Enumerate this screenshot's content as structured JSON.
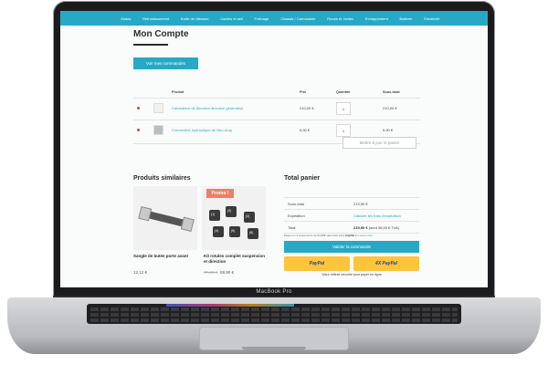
{
  "device_label": "MacBook Pro",
  "nav": {
    "items": [
      "Motos",
      "Refroidissement",
      "Boîte de vitesses",
      "Cadres et sell",
      "Freinage",
      "Chassis / Carrosserie",
      "Roues et Jantes",
      "Echappement",
      "Batterie",
      "Electricité"
    ]
  },
  "page": {
    "title": "Mon Compte",
    "orders_button": "Voir mes commandes"
  },
  "cart": {
    "headers": {
      "product": "Produit",
      "price": "Prix",
      "quantity": "Quantité",
      "subtotal": "Sous-total"
    },
    "rows": [
      {
        "name": "Calculateur de direction direction génération",
        "price": "210,00 €",
        "qty": "1",
        "subtotal": "210,00 €"
      },
      {
        "name": "Connecteur hydraulique de Neo-Amp",
        "price": "9,90 €",
        "qty": "1",
        "subtotal": "9,90 €"
      }
    ],
    "update_button": "Mettre à jour le panier"
  },
  "similar": {
    "title": "Produits similaires",
    "promo_badge": "Promo !",
    "products": [
      {
        "name": "Sangle de butée porte avant",
        "price": "12,12 €",
        "old_price": ""
      },
      {
        "name": "Kit rotules complet suspension et direction",
        "price": "69,90 €",
        "old_price": "77,49 €"
      }
    ],
    "kit_labels": [
      "(1)",
      "(2)",
      "(3)",
      "(4)",
      "(5)",
      "(6)"
    ]
  },
  "totals": {
    "title": "Total panier",
    "rows": [
      {
        "label": "Sous-total",
        "value": "219,90 €"
      },
      {
        "label": "Expédition",
        "value": "Calculer les frais d'expédition"
      },
      {
        "label": "Total",
        "value": "219,90 €",
        "extra": "(dont 36,65 € TVA)"
      }
    ],
    "paypal_note_pre": "Payez en 4 versements de 54,98€ sans frais avec",
    "paypal_brand": "PayPal",
    "paypal_link": "En savoir plus",
    "checkout_button": "Valider la commande",
    "paypal_button": "PayPal",
    "paypal_4x_button": "4X PayPal",
    "secure_note": "Votre réflexe sécurité pour payer en ligne"
  },
  "colors": {
    "accent": "#27a9c6",
    "promo": "#ef8063",
    "paypal_yellow": "#ffc439",
    "remove": "#e03a3a"
  }
}
